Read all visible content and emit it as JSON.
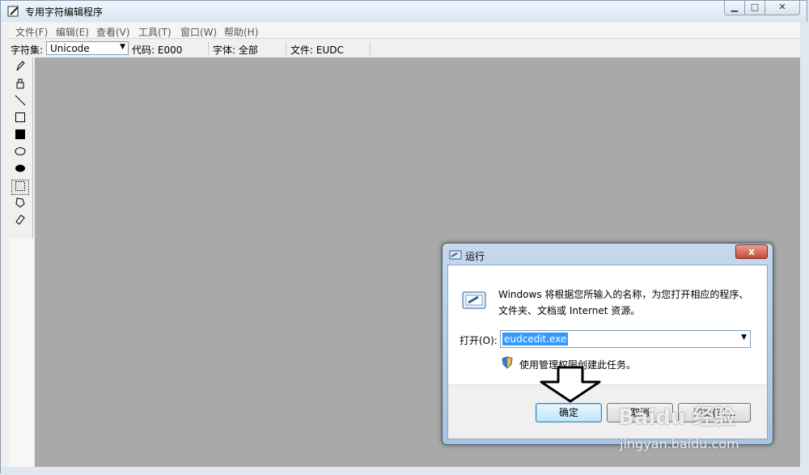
{
  "window": {
    "title": "专用字符编辑程序"
  },
  "menu": [
    "文件(F)",
    "编辑(E)",
    "查看(V)",
    "工具(T)",
    "窗口(W)",
    "帮助(H)"
  ],
  "toolbar": {
    "charset_label": "字符集:",
    "charset_value": "Unicode",
    "code": "代码: E000",
    "font": "字体: 全部",
    "file": "文件: EUDC"
  },
  "tools": [
    "pencil-icon",
    "brush-icon",
    "line-icon",
    "hollow-rectangle-icon",
    "filled-rectangle-icon",
    "hollow-ellipse-icon",
    "filled-ellipse-icon",
    "rect-select-icon",
    "freeform-select-icon",
    "eraser-icon"
  ],
  "dialog": {
    "title": "运行",
    "close": "x",
    "description": "Windows 将根据您所输入的名称，为您打开相应的程序、文件夹、文档或 Internet 资源。",
    "open_label": "打开(O):",
    "open_value": "eudcedit.exe",
    "admin_note": "使用管理权限创建此任务。",
    "ok": "确定",
    "cancel": "取消",
    "browse": "浏览(B)..."
  },
  "watermark": {
    "logo": "Baidu 经验",
    "url": "jingyan.baidu.com"
  }
}
